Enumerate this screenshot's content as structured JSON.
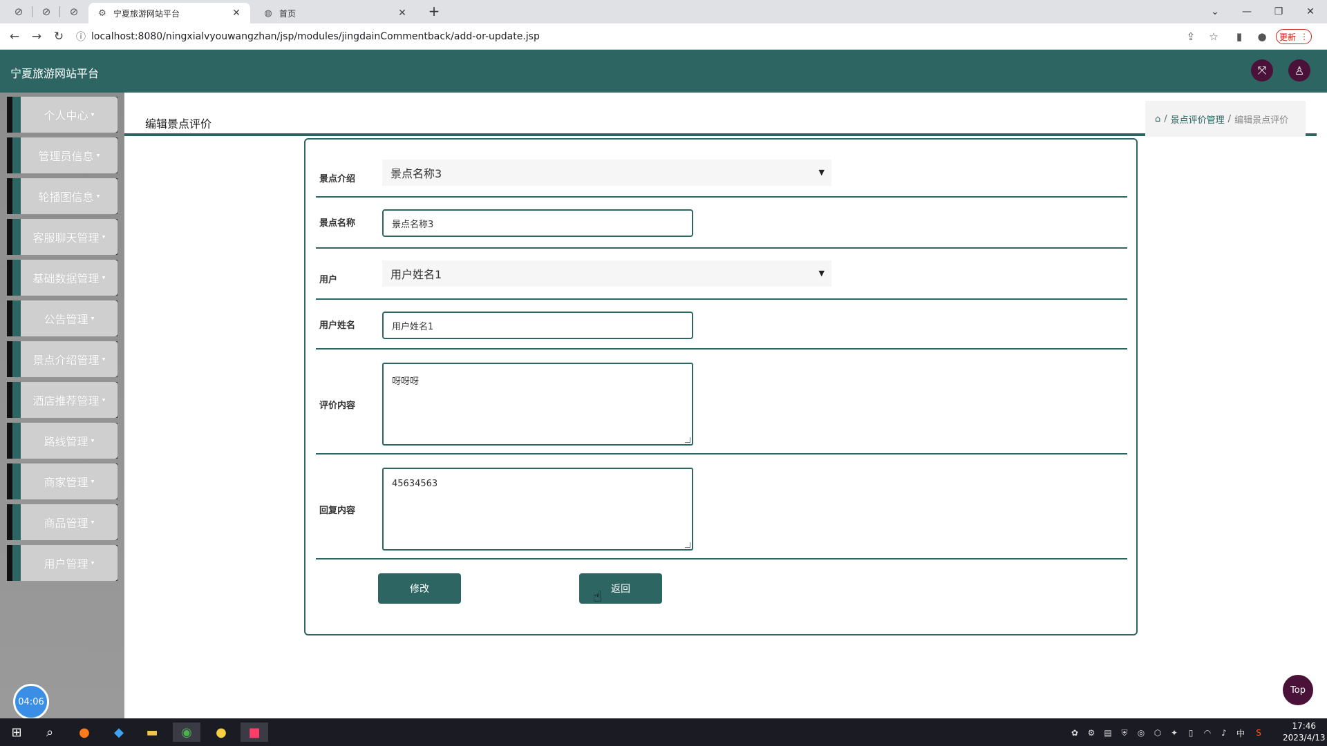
{
  "browser": {
    "tabs": [
      {
        "title": "宁夏旅游网站平台",
        "active": true
      },
      {
        "title": "首页",
        "active": false
      }
    ],
    "url": "localhost:8080/ningxialvyouwangzhan/jsp/modules/jingdainCommentback/add-or-update.jsp",
    "update_label": "更新"
  },
  "header": {
    "title": "宁夏旅游网站平台"
  },
  "sidebar": {
    "items": [
      {
        "label": "个人中心"
      },
      {
        "label": "管理员信息"
      },
      {
        "label": "轮播图信息"
      },
      {
        "label": "客服聊天管理"
      },
      {
        "label": "基础数据管理"
      },
      {
        "label": "公告管理"
      },
      {
        "label": "景点介绍管理"
      },
      {
        "label": "酒店推荐管理"
      },
      {
        "label": "路线管理"
      },
      {
        "label": "商家管理"
      },
      {
        "label": "商品管理"
      },
      {
        "label": "用户管理"
      }
    ],
    "timer": "04:06"
  },
  "page": {
    "title": "编辑景点评价",
    "breadcrumb": {
      "sep": "/",
      "parent": "景点评价管理",
      "current": "编辑景点评价"
    }
  },
  "form": {
    "spot_intro": {
      "label": "景点介绍",
      "value": "景点名称3"
    },
    "spot_name": {
      "label": "景点名称",
      "value": "景点名称3"
    },
    "user": {
      "label": "用户",
      "value": "用户姓名1"
    },
    "user_name": {
      "label": "用户姓名",
      "value": "用户姓名1"
    },
    "comment": {
      "label": "评价内容",
      "value": "呀呀呀"
    },
    "reply": {
      "label": "回复内容",
      "value": "45634563"
    },
    "submit_label": "修改",
    "back_label": "返回"
  },
  "top_label": "Top",
  "taskbar": {
    "time": "17:46",
    "date": "2023/4/13",
    "ime": "中"
  },
  "colors": {
    "primary": "#2d6562",
    "accent": "#4a1239"
  }
}
